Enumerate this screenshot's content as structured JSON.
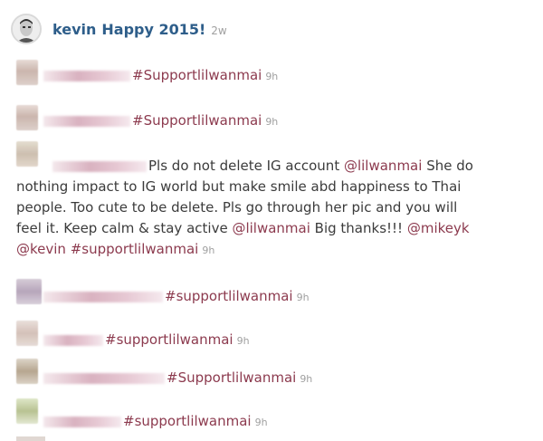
{
  "post": {
    "username": "kevin",
    "caption": "Happy 2015!",
    "time": "2w"
  },
  "comments": [
    {
      "text": "#Supportlilwanmai",
      "time": "9h"
    },
    {
      "text": "#Supportlilwanmai",
      "time": "9h"
    },
    {
      "lines": [
        {
          "parts": [
            "Pls do not delete IG account ",
            "@lilwanmai",
            " She do"
          ]
        },
        {
          "parts": [
            "nothing impact to IG world but make smile abd happiness to Thai"
          ]
        },
        {
          "parts": [
            "people. Too cute to be delete. Pls go through her pic and you will"
          ]
        },
        {
          "parts": [
            "feel it. Keep calm & stay active ",
            "@lilwanmai",
            " Big thanks!!! ",
            "@mikeyk"
          ]
        },
        {
          "parts": [
            "@kevin",
            " ",
            "#supportlilwanmai"
          ]
        }
      ],
      "time": "9h"
    },
    {
      "text": "#supportlilwanmai",
      "time": "9h"
    },
    {
      "text": "#supportlilwanmai",
      "time": "9h"
    },
    {
      "text": "#Supportlilwanmai",
      "time": "9h"
    },
    {
      "text": "#supportlilwanmai",
      "time": "9h"
    }
  ]
}
